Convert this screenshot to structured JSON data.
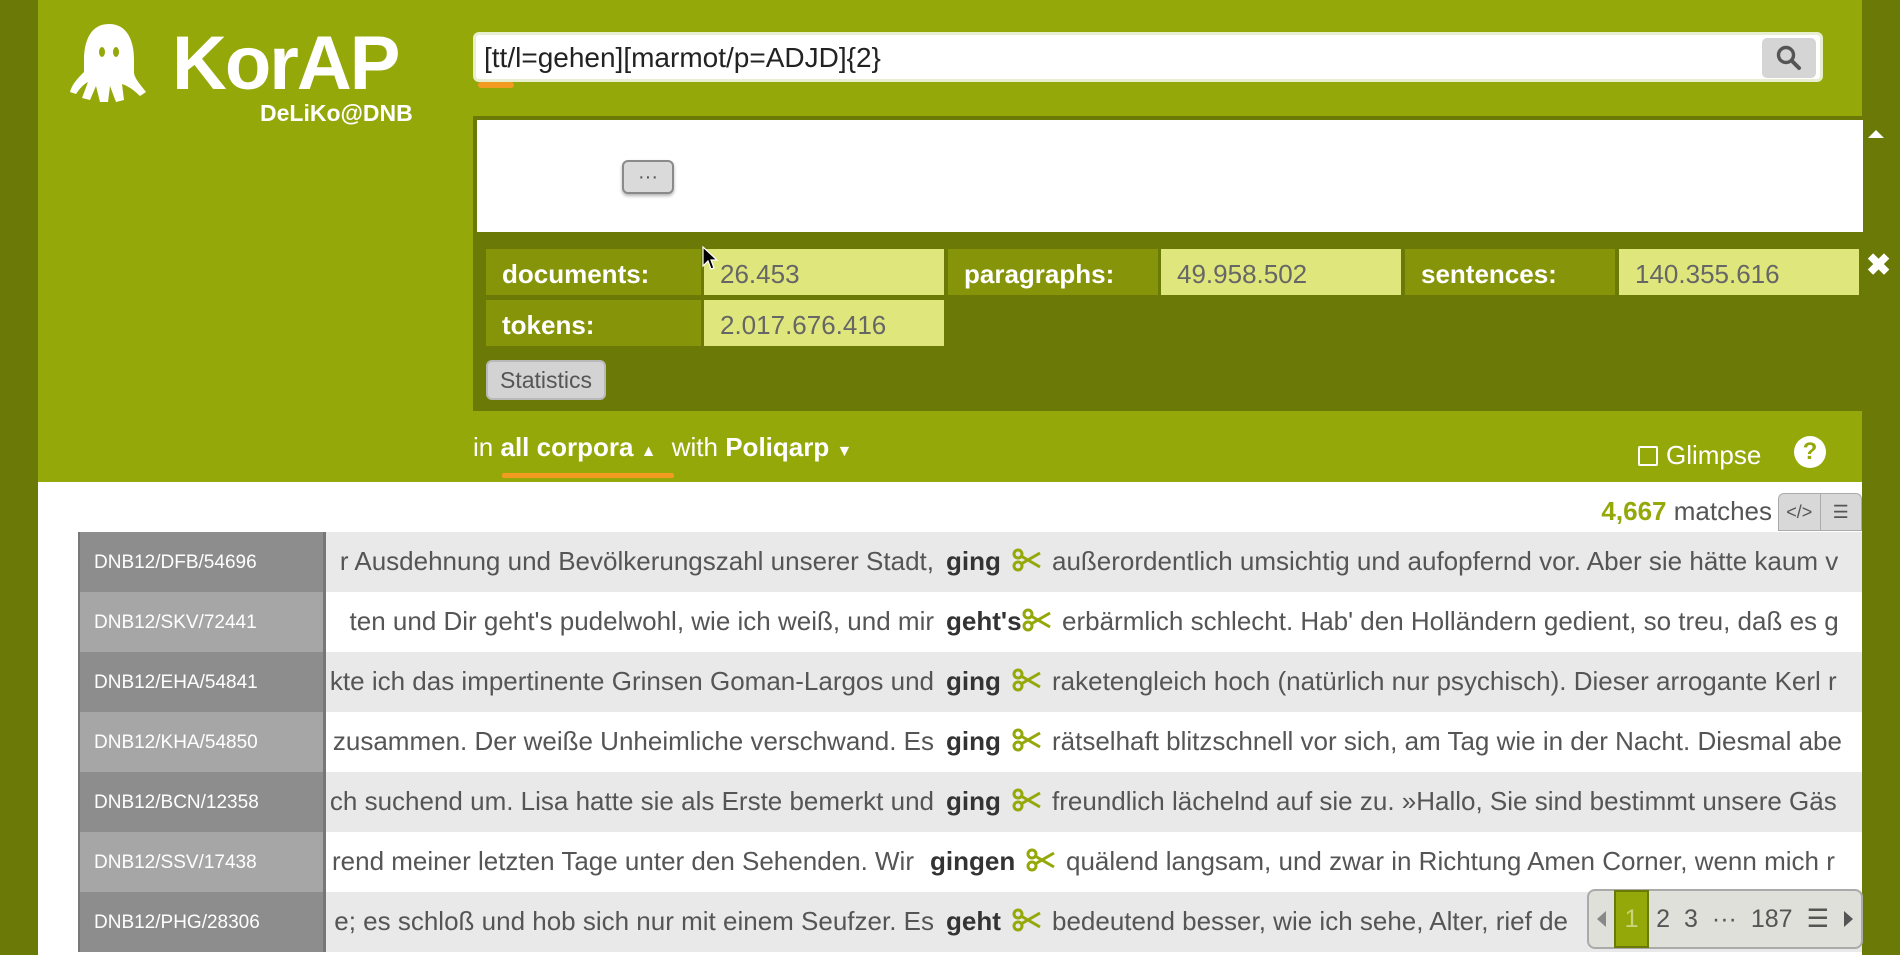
{
  "branding": {
    "name": "KorAP",
    "instance": "DeLiKo@DNB"
  },
  "search": {
    "query": "[tt/l=gehen][marmot/p=ADJD]{2}"
  },
  "query_panel": {
    "more_button": "···",
    "stats": [
      {
        "key": "documents:",
        "value": "26.453"
      },
      {
        "key": "paragraphs:",
        "value": "49.958.502"
      },
      {
        "key": "sentences:",
        "value": "140.355.616"
      },
      {
        "key": "tokens:",
        "value": "2.017.676.416"
      }
    ],
    "statistics_button": "Statistics"
  },
  "vc_bar": {
    "in_label": "in",
    "corpus": "all corpora",
    "with_label": "with",
    "query_language": "Poliqarp",
    "glimpse_label": "Glimpse",
    "glimpse_checked": false
  },
  "results": {
    "match_count": "4,667",
    "match_label": "matches",
    "rows": [
      {
        "sig": "DNB12/DFB/54696",
        "left": "r Ausdehnung und Bevölkerungszahl unserer Stadt,",
        "match": "ging",
        "right": "außerordentlich umsichtig und aufopfernd vor. Aber sie hätte kaum v"
      },
      {
        "sig": "DNB12/SKV/72441",
        "left": "ten und Dir geht's pudelwohl, wie ich weiß, und mir",
        "match": "geht's",
        "right": "erbärmlich schlecht. Hab' den Holländern gedient, so treu, daß es g"
      },
      {
        "sig": "DNB12/EHA/54841",
        "left": "kte ich das impertinente Grinsen Goman-Largos und",
        "match": "ging",
        "right": "raketengleich hoch (natürlich nur psychisch). Dieser arrogante Kerl r"
      },
      {
        "sig": "DNB12/KHA/54850",
        "left": "zusammen. Der weiße Unheimliche verschwand. Es",
        "match": "ging",
        "right": "rätselhaft blitzschnell vor sich, am Tag wie in der Nacht. Diesmal abe"
      },
      {
        "sig": "DNB12/BCN/12358",
        "left": "ch suchend um. Lisa hatte sie als Erste bemerkt und",
        "match": "ging",
        "right": "freundlich lächelnd auf sie zu. »Hallo, Sie sind bestimmt unsere Gäs"
      },
      {
        "sig": "DNB12/SSV/17438",
        "left": "rend meiner letzten Tage unter den Sehenden. Wir",
        "match": "gingen",
        "right": "quälend langsam, und zwar in Richtung Amen Corner, wenn mich r"
      },
      {
        "sig": "DNB12/PHG/28306",
        "left": "e; es schloß und hob sich nur mit einem Seufzer. Es",
        "match": "geht",
        "right": "bedeutend besser, wie ich sehe, Alter, rief de"
      }
    ]
  },
  "pagination": {
    "current": "1",
    "pages": [
      "2",
      "3"
    ],
    "ellipsis": "···",
    "last": "187"
  },
  "icons": [
    "ghost-logo-icon",
    "search-icon",
    "collapse-icon",
    "close-icon",
    "help-icon",
    "code-view-icon",
    "text-view-icon",
    "scissors-icon",
    "menu-icon",
    "prev-icon",
    "next-icon",
    "dropdown-up-icon",
    "dropdown-down-icon"
  ]
}
